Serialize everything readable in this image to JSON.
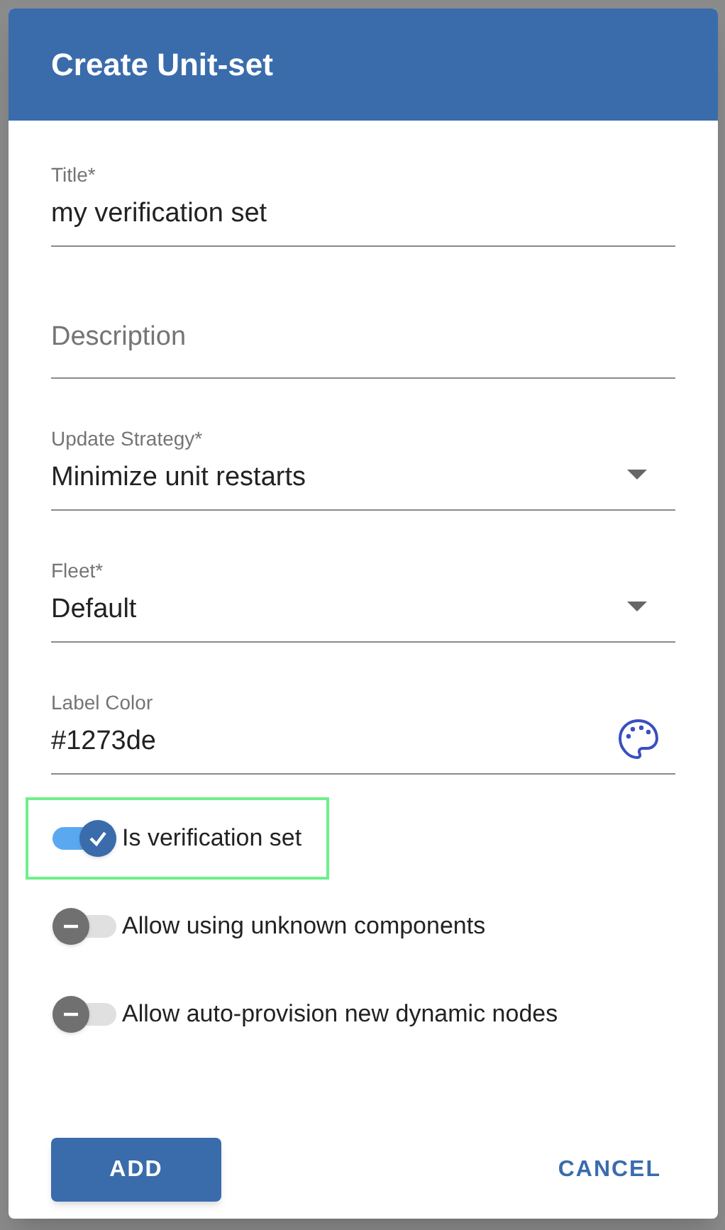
{
  "dialog": {
    "title": "Create Unit-set"
  },
  "fields": [
    {
      "kind": "text",
      "label": "Title*",
      "value": "my verification set"
    },
    {
      "kind": "text",
      "placeholder": "Description"
    },
    {
      "kind": "select",
      "label": "Update Strategy*",
      "value": "Minimize unit restarts"
    },
    {
      "kind": "select",
      "label": "Fleet*",
      "value": "Default"
    },
    {
      "kind": "color",
      "label": "Label Color",
      "value": "#1273de"
    }
  ],
  "switches": [
    {
      "label": "Is verification set",
      "on": true,
      "focused": true
    },
    {
      "label": "Allow using unknown components",
      "on": false,
      "focused": false
    },
    {
      "label": "Allow auto-provision new dynamic nodes",
      "on": false,
      "focused": false
    }
  ],
  "buttons": [
    {
      "kind": "primary",
      "label": "ADD"
    },
    {
      "kind": "text",
      "label": "CANCEL"
    }
  ]
}
